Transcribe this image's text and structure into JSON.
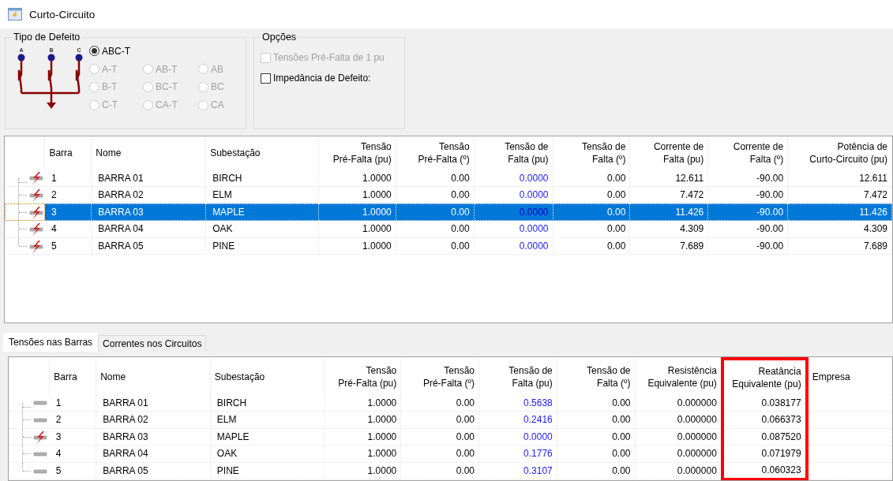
{
  "window": {
    "title": "Curto-Circuito"
  },
  "fault_type": {
    "title": "Tipo de Defeito",
    "diagram_labels": [
      "A",
      "B",
      "C"
    ],
    "options": [
      {
        "label": "ABC-T",
        "selected": true,
        "disabled": false
      },
      {
        "label": "A-T",
        "selected": false,
        "disabled": true
      },
      {
        "label": "AB-T",
        "selected": false,
        "disabled": true
      },
      {
        "label": "AB",
        "selected": false,
        "disabled": true
      },
      {
        "label": "B-T",
        "selected": false,
        "disabled": true
      },
      {
        "label": "BC-T",
        "selected": false,
        "disabled": true
      },
      {
        "label": "BC",
        "selected": false,
        "disabled": true
      },
      {
        "label": "C-T",
        "selected": false,
        "disabled": true
      },
      {
        "label": "CA-T",
        "selected": false,
        "disabled": true
      },
      {
        "label": "CA",
        "selected": false,
        "disabled": true
      }
    ]
  },
  "options": {
    "title": "Opções",
    "checkboxes": [
      {
        "label": "Tensões Pré-Falta de 1 pu",
        "checked": false,
        "disabled": true
      },
      {
        "label": "Impedância de Defeito:",
        "checked": false,
        "disabled": false
      }
    ]
  },
  "results_table": {
    "columns": [
      {
        "label": "Barra",
        "kind": "text"
      },
      {
        "label": "Nome",
        "kind": "text"
      },
      {
        "label": "Subestação",
        "kind": "text"
      },
      {
        "label": "Tensão\nPré-Falta (pu)",
        "kind": "number"
      },
      {
        "label": "Tensão\nPré-Falta (º)",
        "kind": "number"
      },
      {
        "label": "Tensão de\nFalta (pu)",
        "kind": "fault-voltage"
      },
      {
        "label": "Tensão de\nFalta (º)",
        "kind": "number"
      },
      {
        "label": "Corrente de\nFalta (pu)",
        "kind": "number"
      },
      {
        "label": "Corrente de\nFalta (º)",
        "kind": "number"
      },
      {
        "label": "Potência de\nCurto-Circuito (pu)",
        "kind": "number"
      }
    ],
    "rows": [
      {
        "kind": "fault",
        "selected": false,
        "cells": [
          "1",
          "BARRA 01",
          "BIRCH",
          "1.0000",
          "0.00",
          "0.0000",
          "0.00",
          "12.611",
          "-90.00",
          "12.611"
        ]
      },
      {
        "kind": "fault",
        "selected": false,
        "cells": [
          "2",
          "BARRA 02",
          "ELM",
          "1.0000",
          "0.00",
          "0.0000",
          "0.00",
          "7.472",
          "-90.00",
          "7.472"
        ]
      },
      {
        "kind": "fault",
        "selected": true,
        "cells": [
          "3",
          "BARRA 03",
          "MAPLE",
          "1.0000",
          "0.00",
          "0.0000",
          "0.00",
          "11.426",
          "-90.00",
          "11.426"
        ]
      },
      {
        "kind": "fault",
        "selected": false,
        "cells": [
          "4",
          "BARRA 04",
          "OAK",
          "1.0000",
          "0.00",
          "0.0000",
          "0.00",
          "4.309",
          "-90.00",
          "4.309"
        ]
      },
      {
        "kind": "fault",
        "selected": false,
        "cells": [
          "5",
          "BARRA 05",
          "PINE",
          "1.0000",
          "0.00",
          "0.0000",
          "0.00",
          "7.689",
          "-90.00",
          "7.689"
        ]
      }
    ]
  },
  "tabs": [
    {
      "label": "Tensões nas Barras",
      "selected": true
    },
    {
      "label": "Correntes nos Circuitos",
      "selected": false
    }
  ],
  "voltages_table": {
    "columns": [
      {
        "label": "Barra",
        "kind": "text",
        "highlighted": false
      },
      {
        "label": "Nome",
        "kind": "text",
        "highlighted": false
      },
      {
        "label": "Subestação",
        "kind": "text",
        "highlighted": false
      },
      {
        "label": "Tensão\nPré-Falta (pu)",
        "kind": "number",
        "highlighted": false
      },
      {
        "label": "Tensão\nPré-Falta (º)",
        "kind": "number",
        "highlighted": false
      },
      {
        "label": "Tensão de\nFalta (pu)",
        "kind": "fault-voltage",
        "highlighted": false
      },
      {
        "label": "Tensão de\nFalta (º)",
        "kind": "number",
        "highlighted": false
      },
      {
        "label": "Resistência\nEquivalente (pu)",
        "kind": "number",
        "highlighted": false
      },
      {
        "label": "Reatância\nEquivalente (pu)",
        "kind": "number",
        "highlighted": true
      },
      {
        "label": "Empresa",
        "kind": "text",
        "highlighted": false
      }
    ],
    "rows": [
      {
        "kind": "bus",
        "cells": [
          "1",
          "BARRA 01",
          "BIRCH",
          "1.0000",
          "0.00",
          "0.5638",
          "0.00",
          "0.000000",
          "0.038177"
        ]
      },
      {
        "kind": "bus",
        "cells": [
          "2",
          "BARRA 02",
          "ELM",
          "1.0000",
          "0.00",
          "0.2416",
          "0.00",
          "0.000000",
          "0.066373"
        ]
      },
      {
        "kind": "fault",
        "cells": [
          "3",
          "BARRA 03",
          "MAPLE",
          "1.0000",
          "0.00",
          "0.0000",
          "0.00",
          "0.000000",
          "0.087520"
        ]
      },
      {
        "kind": "bus",
        "cells": [
          "4",
          "BARRA 04",
          "OAK",
          "1.0000",
          "0.00",
          "0.1776",
          "0.00",
          "0.000000",
          "0.071979"
        ]
      },
      {
        "kind": "bus",
        "cells": [
          "5",
          "BARRA 05",
          "PINE",
          "1.0000",
          "0.00",
          "0.3107",
          "0.00",
          "0.000000",
          "0.060323"
        ]
      }
    ]
  }
}
